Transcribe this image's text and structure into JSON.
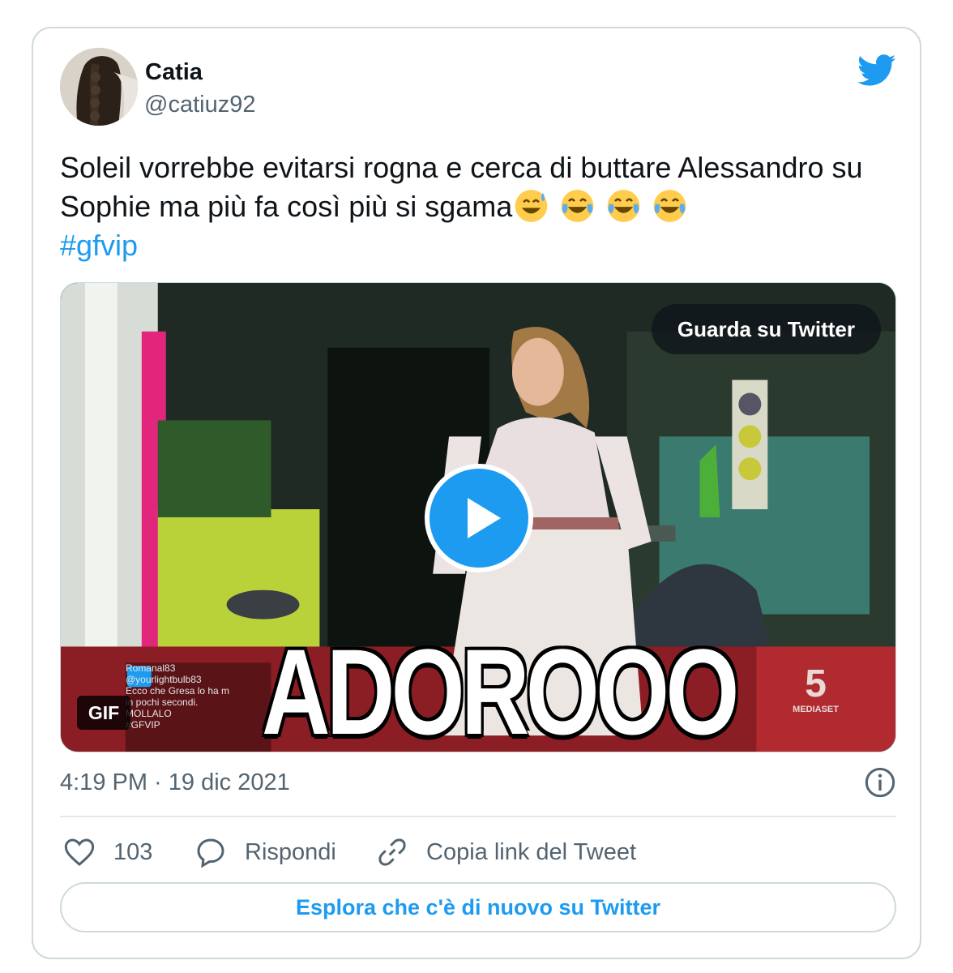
{
  "author": {
    "name": "Catia",
    "handle": "@catiuz92"
  },
  "tweet": {
    "text": "Soleil vorrebbe evitarsi rogna e cerca di buttare Alessandro su Sophie ma più fa così più si sgama",
    "emojis": [
      "grinning-sweat-emoji",
      "tears-of-joy-emoji",
      "tears-of-joy-emoji",
      "tears-of-joy-emoji"
    ],
    "hashtag": "#gfvip"
  },
  "media": {
    "watch_label": "Guarda su Twitter",
    "gif_badge": "GIF",
    "caption": "ADOROOO",
    "ticker_lines": [
      "Romanal83",
      "@yourlightbulb83",
      "Ecco che Gresa lo ha m",
      "in pochi secondi.",
      "MOLLALO",
      "#GFVIP"
    ],
    "channel_logo": "5",
    "channel_name": "MEDIASET"
  },
  "meta": {
    "timestamp": "4:19 PM · 19 dic 2021"
  },
  "actions": {
    "likes": "103",
    "reply_label": "Rispondi",
    "copy_label": "Copia link del Tweet"
  },
  "footer": {
    "explore_label": "Esplora che c'è di nuovo su Twitter"
  },
  "colors": {
    "accent": "#1d9bf0",
    "text": "#0f1419",
    "secondary": "#536471",
    "border": "#cfd9de"
  }
}
